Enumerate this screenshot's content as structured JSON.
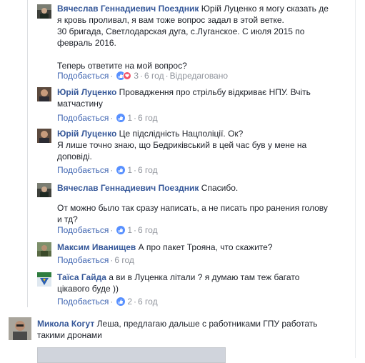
{
  "colors": {
    "author": "#365899",
    "like_link": "#4267b2",
    "meta_gray": "#90949c",
    "like_reaction": "#5890ff",
    "love_reaction": "#f25268"
  },
  "comments": [
    {
      "author": "Вячеслав Геннадиевич Поездник",
      "text_lines": [
        "Юрій Луценко я могу сказать де",
        "я кровь проливал, я вам тоже вопрос задал в этой ветке.",
        "30 бригада, Светлодарская дуга, с.Луганское. С июля 2015 по",
        "февраль 2016.",
        "",
        "Теперь ответите на мой вопрос?"
      ],
      "like_label": "Подобається",
      "reactions": [
        "like-icon",
        "love-icon"
      ],
      "reaction_count": "3",
      "time": "6 год",
      "edited": "Відредаговано"
    },
    {
      "author": "Юрій Луценко",
      "text_lines": [
        "Провадження про стрільбу відкриває НПУ. Вчіть",
        "матчастину"
      ],
      "like_label": "Подобається",
      "reactions": [
        "like-icon"
      ],
      "reaction_count": "1",
      "time": "6 год"
    },
    {
      "author": "Юрій Луценко",
      "text_lines": [
        "Це підслідність Нацполіції. Ок?",
        "Я лише точно знаю, що Бедриківський в цей час був у мене на",
        "доповіді."
      ],
      "like_label": "Подобається",
      "reactions": [
        "like-icon"
      ],
      "reaction_count": "1",
      "time": "6 год"
    },
    {
      "author": "Вячеслав Геннадиевич Поездник",
      "text_lines": [
        "Спасибо.",
        "",
        "От можно было так сразу написать, а не писать про ранения голову",
        "и тд?"
      ],
      "like_label": "Подобається",
      "reactions": [
        "like-icon"
      ],
      "reaction_count": "1",
      "time": "6 год"
    },
    {
      "author": "Максим Иванищев",
      "text_lines": [
        "А про пакет Трояна, что скажите?"
      ],
      "like_label": "Подобається",
      "time": "6 год"
    },
    {
      "author": "Таїса Гайда",
      "text_lines": [
        "а ви в Луценка літали ? я думаю там теж багато",
        "цікавого буде ))"
      ],
      "like_label": "Подобається",
      "reactions": [
        "like-icon"
      ],
      "reaction_count": "2",
      "time": "6 год"
    },
    {
      "author": "Микола Когут",
      "text_lines": [
        "Леша, предлагаю дальше с работниками ГПУ работать",
        "такими дронами"
      ]
    }
  ],
  "separator": "·"
}
